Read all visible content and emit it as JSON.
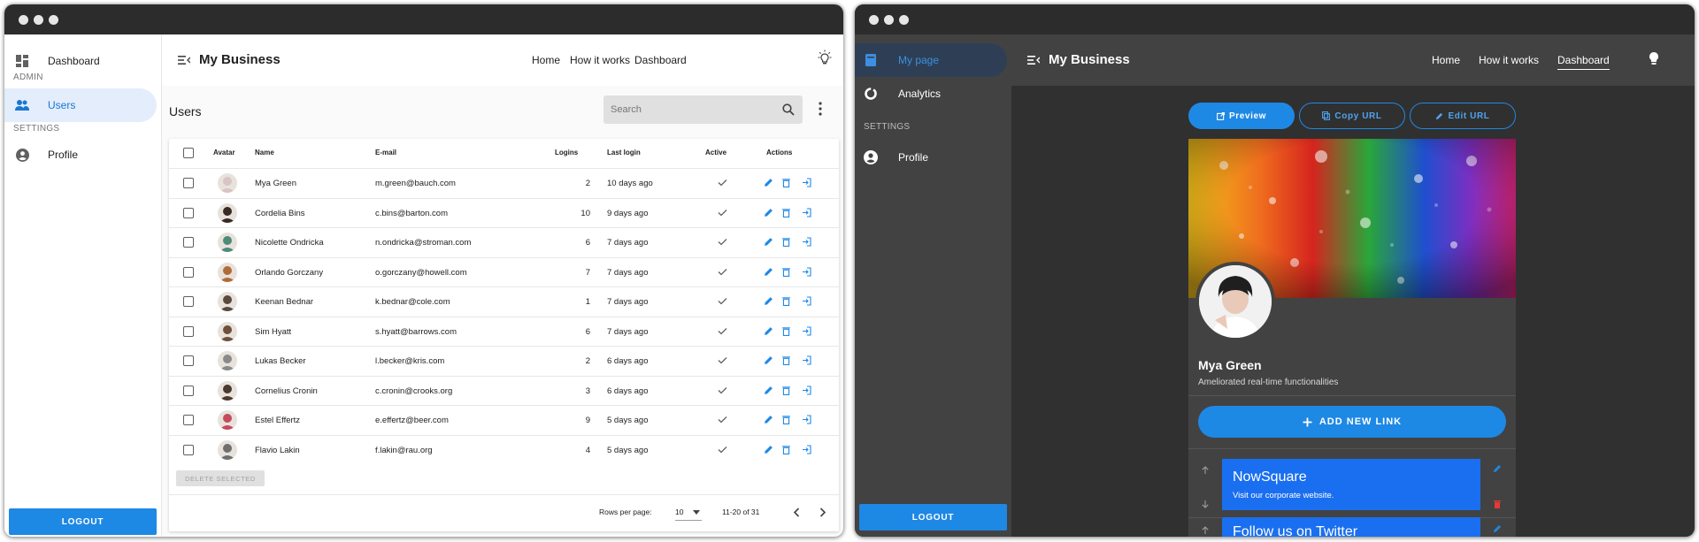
{
  "colors": {
    "accent": "#1e88e5",
    "active_nav_bg": "#e3edfb",
    "dark_bg": "#303030",
    "dark_panel": "#424242",
    "link_card": "#1a6ff0",
    "delete_red": "#e53935"
  },
  "light": {
    "sidebar": {
      "items": [
        {
          "label": "Dashboard",
          "icon": "dashboard-icon"
        }
      ],
      "admin_title": "ADMIN",
      "admin_items": [
        {
          "label": "Users",
          "icon": "users-icon",
          "active": true
        }
      ],
      "settings_title": "SETTINGS",
      "settings_items": [
        {
          "label": "Profile",
          "icon": "account-circle-icon"
        }
      ],
      "logout": "LOGOUT"
    },
    "header": {
      "title": "My Business",
      "nav": [
        "Home",
        "How it works",
        "Dashboard"
      ],
      "theme_icon": "lightbulb-outline-icon"
    },
    "page": {
      "title": "Users",
      "search_placeholder": "Search"
    },
    "table": {
      "columns": [
        "Avatar",
        "Name",
        "E-mail",
        "Logins",
        "Last login",
        "Active",
        "Actions"
      ],
      "rows": [
        {
          "name": "Mya Green",
          "email": "m.green@bauch.com",
          "logins": "2",
          "last_login": "10 days ago"
        },
        {
          "name": "Cordelia Bins",
          "email": "c.bins@barton.com",
          "logins": "10",
          "last_login": "9 days ago"
        },
        {
          "name": "Nicolette Ondricka",
          "email": "n.ondricka@stroman.com",
          "logins": "6",
          "last_login": "7 days ago"
        },
        {
          "name": "Orlando Gorczany",
          "email": "o.gorczany@howell.com",
          "logins": "7",
          "last_login": "7 days ago"
        },
        {
          "name": "Keenan Bednar",
          "email": "k.bednar@cole.com",
          "logins": "1",
          "last_login": "7 days ago"
        },
        {
          "name": "Sim Hyatt",
          "email": "s.hyatt@barrows.com",
          "logins": "6",
          "last_login": "7 days ago"
        },
        {
          "name": "Lukas Becker",
          "email": "l.becker@kris.com",
          "logins": "2",
          "last_login": "6 days ago"
        },
        {
          "name": "Cornelius Cronin",
          "email": "c.cronin@crooks.org",
          "logins": "3",
          "last_login": "6 days ago"
        },
        {
          "name": "Estel Effertz",
          "email": "e.effertz@beer.com",
          "logins": "9",
          "last_login": "5 days ago"
        },
        {
          "name": "Flavio Lakin",
          "email": "f.lakin@rau.org",
          "logins": "4",
          "last_login": "5 days ago"
        }
      ],
      "delete_selected": "DELETE SELECTED",
      "rows_per_page_label": "Rows per page:",
      "rows_per_page": "10",
      "range": "11-20 of 31"
    }
  },
  "dark": {
    "sidebar": {
      "items": [
        {
          "label": "My page",
          "icon": "web-page-icon",
          "active": true
        },
        {
          "label": "Analytics",
          "icon": "donut-chart-icon"
        }
      ],
      "settings_title": "SETTINGS",
      "settings_items": [
        {
          "label": "Profile",
          "icon": "account-circle-icon"
        }
      ],
      "logout": "LOGOUT"
    },
    "header": {
      "title": "My Business",
      "nav": [
        "Home",
        "How it works",
        "Dashboard"
      ],
      "theme_icon": "lightbulb-icon"
    },
    "actions": [
      "Preview",
      "Copy URL",
      "Edit URL"
    ],
    "profile": {
      "name": "Mya Green",
      "subtitle": "Ameliorated real-time functionalities",
      "add_link": "ADD NEW LINK"
    },
    "links": [
      {
        "title": "NowSquare",
        "subtitle": "Visit our corporate website."
      },
      {
        "title": "Follow us on Twitter",
        "subtitle": ""
      }
    ]
  }
}
